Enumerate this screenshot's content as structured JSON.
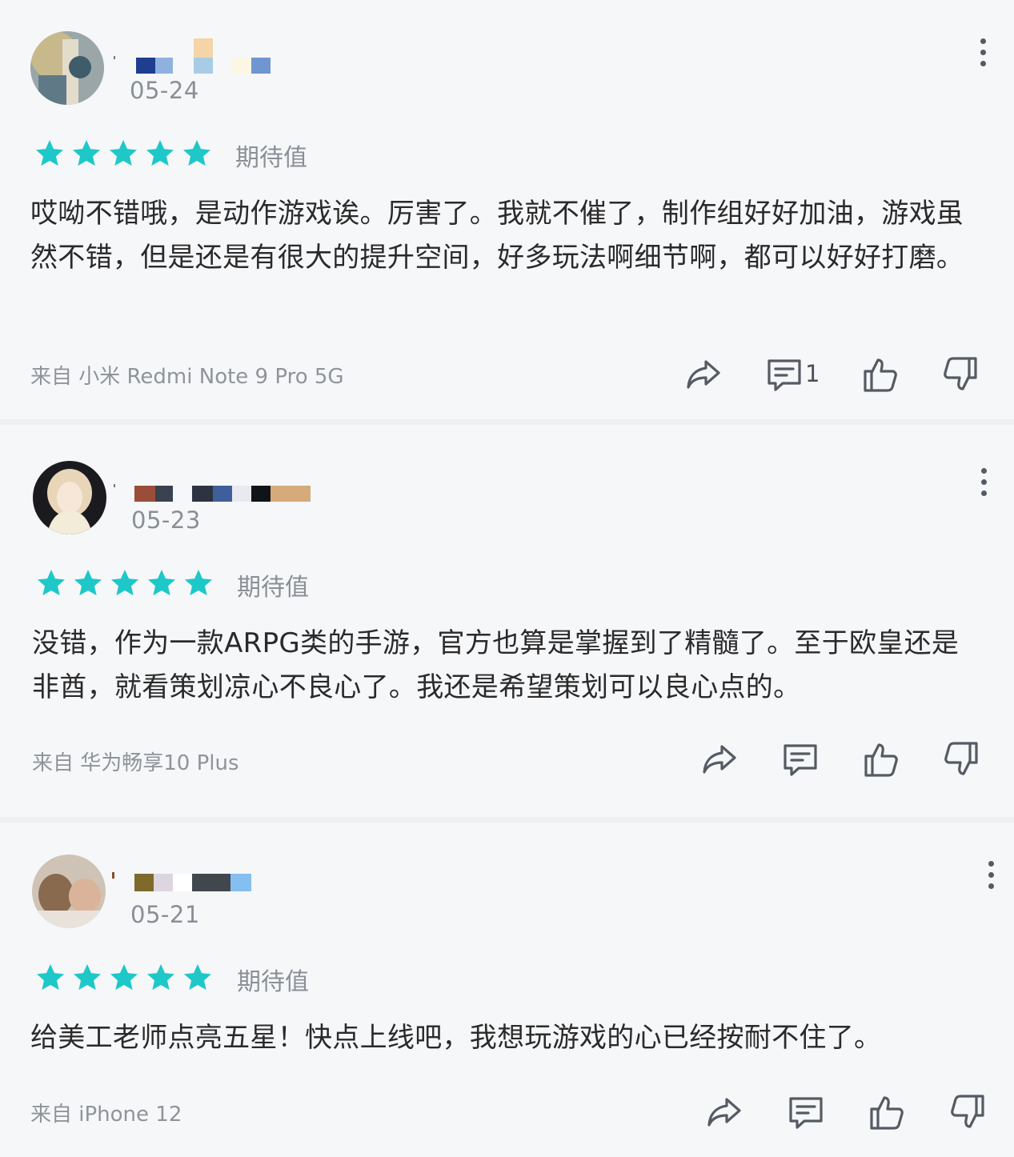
{
  "reviews": [
    {
      "date": "05-24",
      "rating": 5,
      "rating_label": "期待值",
      "content": "哎呦不错哦，是动作游戏诶。厉害了。我就不催了，制作组好好加油，游戏虽然不错，但是还是有很大的提升空间，好多玩法啊细节啊，都可以好好打磨。",
      "source": "来自 小米 Redmi Note 9 Pro 5G",
      "comment_count": "1"
    },
    {
      "date": "05-23",
      "rating": 5,
      "rating_label": "期待值",
      "content": "没错，作为一款ARPG类的手游，官方也算是掌握到了精髓了。至于欧皇还是非酋，就看策划凉心不良心了。我还是希望策划可以良心点的。",
      "source": "来自 华为畅享10 Plus",
      "comment_count": ""
    },
    {
      "date": "05-21",
      "rating": 5,
      "rating_label": "期待值",
      "content": "给美工老师点亮五星！快点上线吧，我想玩游戏的心已经按耐不住了。",
      "source": "来自 iPhone 12",
      "comment_count": ""
    }
  ],
  "colors": {
    "star": "#1ec8c8",
    "icon": "#555b63",
    "muted_text": "#8a8f96"
  },
  "icons": [
    "share-icon",
    "comment-icon",
    "thumbs-up-icon",
    "thumbs-down-icon",
    "more-vertical-icon"
  ]
}
